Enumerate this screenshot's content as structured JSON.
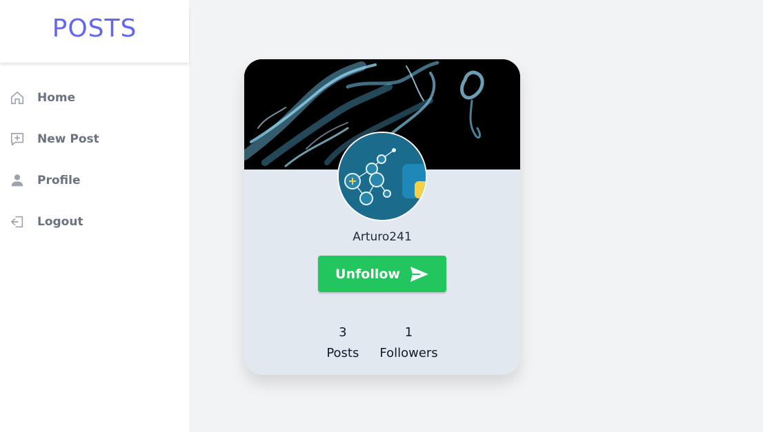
{
  "sidebar": {
    "brand": "POSTS",
    "items": [
      {
        "label": "Home",
        "icon": "home-icon"
      },
      {
        "label": "New Post",
        "icon": "new-post-icon"
      },
      {
        "label": "Profile",
        "icon": "user-icon"
      },
      {
        "label": "Logout",
        "icon": "logout-icon"
      }
    ]
  },
  "profile": {
    "username": "Arturo241",
    "follow_button_label": "Unfollow",
    "follow_button_icon": "send-icon",
    "stats": [
      {
        "value": "3",
        "label": "Posts"
      },
      {
        "value": "1",
        "label": "Followers"
      }
    ]
  },
  "colors": {
    "brand": "#6366f1",
    "button": "#22c55e",
    "card_bg": "#e2e8f0",
    "nav_text": "#6b7280"
  }
}
